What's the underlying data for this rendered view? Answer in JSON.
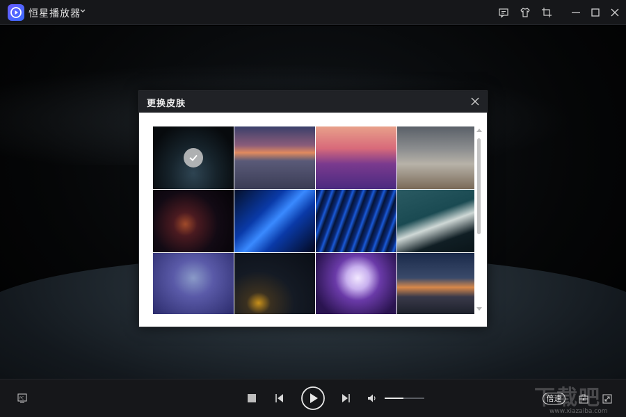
{
  "app": {
    "title": "恒星播放器",
    "brand_color": "#4f63ff"
  },
  "titlebar": {
    "icons": [
      "feedback-icon",
      "skin-icon",
      "crop-icon",
      "minimize-icon",
      "maximize-icon",
      "close-icon"
    ]
  },
  "dialog": {
    "title": "更换皮肤",
    "selected_index": 0
  },
  "controls": {
    "speed_label": "倍速",
    "volume_level": 0.48
  },
  "watermark": {
    "text": "下载吧",
    "url": "www.xiazaiba.com"
  }
}
